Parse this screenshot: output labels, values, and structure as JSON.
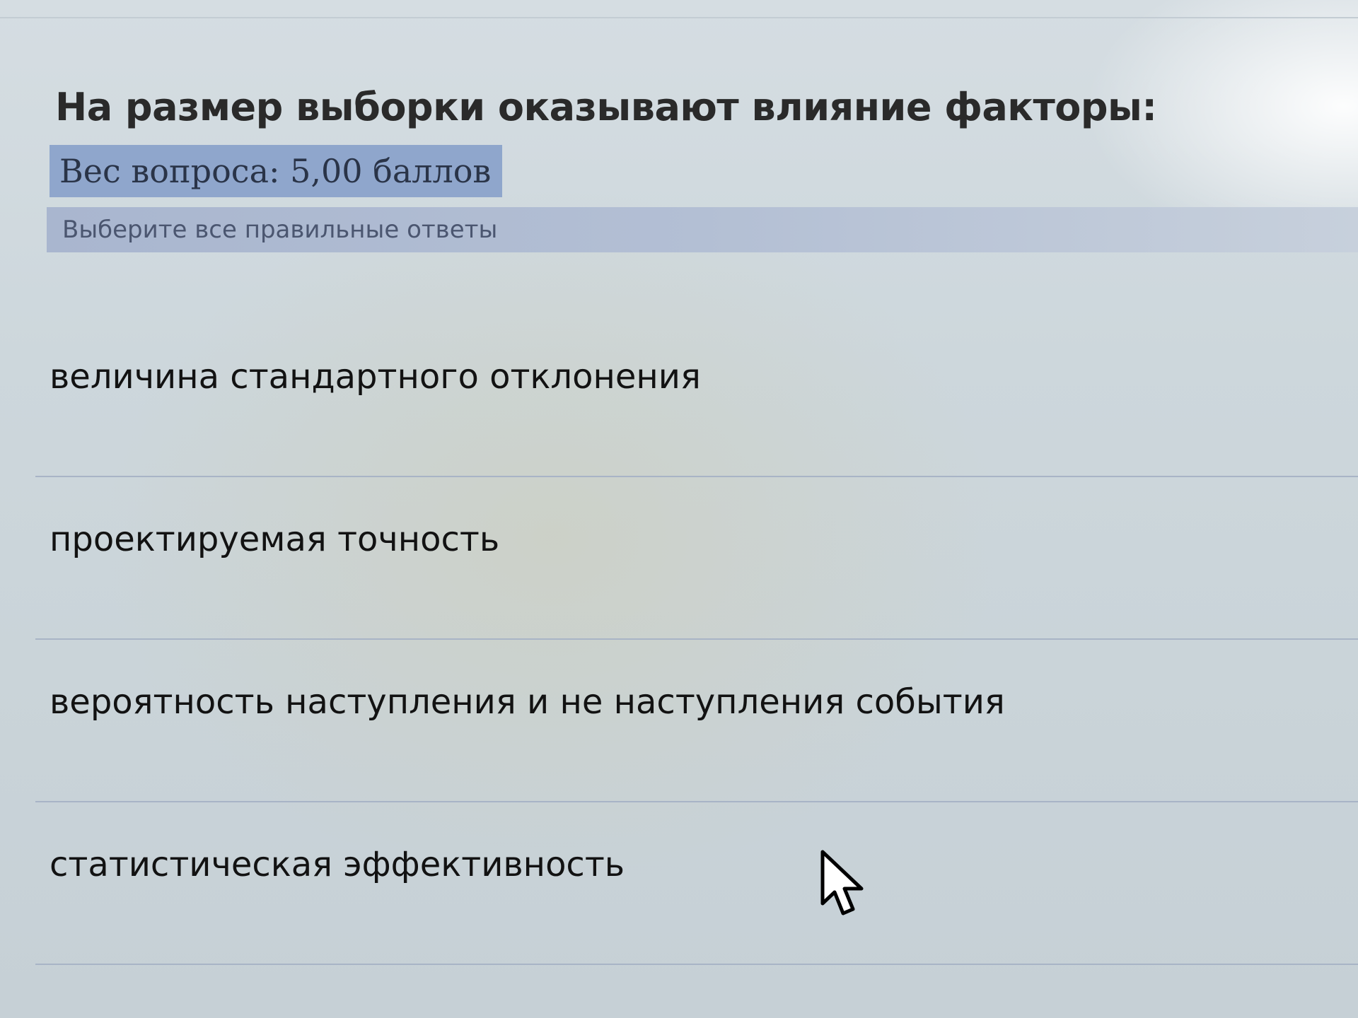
{
  "question": {
    "title": "На размер выборки оказывают влияние факторы:",
    "weight": "Вес вопроса: 5,00 баллов",
    "instruction": "Выберите все правильные ответы"
  },
  "answers": [
    {
      "label": "величина стандартного отклонения"
    },
    {
      "label": "проектируемая точность"
    },
    {
      "label": "вероятность наступления и не наступления события"
    },
    {
      "label": "статистическая эффективность"
    }
  ],
  "colors": {
    "weight_badge_bg": "#8fa6cc",
    "instruction_bar_bg": "#a9b6cf",
    "divider": "#a8b4c6"
  },
  "icons": {
    "cursor": "mouse-pointer-arrow-icon"
  }
}
